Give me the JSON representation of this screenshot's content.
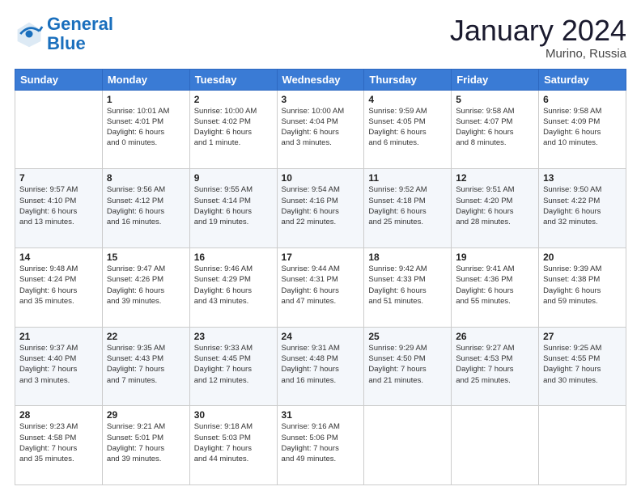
{
  "header": {
    "logo_general": "General",
    "logo_blue": "Blue",
    "month_title": "January 2024",
    "location": "Murino, Russia"
  },
  "weekdays": [
    "Sunday",
    "Monday",
    "Tuesday",
    "Wednesday",
    "Thursday",
    "Friday",
    "Saturday"
  ],
  "weeks": [
    [
      {
        "day": "",
        "info": ""
      },
      {
        "day": "1",
        "info": "Sunrise: 10:01 AM\nSunset: 4:01 PM\nDaylight: 6 hours\nand 0 minutes."
      },
      {
        "day": "2",
        "info": "Sunrise: 10:00 AM\nSunset: 4:02 PM\nDaylight: 6 hours\nand 1 minute."
      },
      {
        "day": "3",
        "info": "Sunrise: 10:00 AM\nSunset: 4:04 PM\nDaylight: 6 hours\nand 3 minutes."
      },
      {
        "day": "4",
        "info": "Sunrise: 9:59 AM\nSunset: 4:05 PM\nDaylight: 6 hours\nand 6 minutes."
      },
      {
        "day": "5",
        "info": "Sunrise: 9:58 AM\nSunset: 4:07 PM\nDaylight: 6 hours\nand 8 minutes."
      },
      {
        "day": "6",
        "info": "Sunrise: 9:58 AM\nSunset: 4:09 PM\nDaylight: 6 hours\nand 10 minutes."
      }
    ],
    [
      {
        "day": "7",
        "info": "Sunrise: 9:57 AM\nSunset: 4:10 PM\nDaylight: 6 hours\nand 13 minutes."
      },
      {
        "day": "8",
        "info": "Sunrise: 9:56 AM\nSunset: 4:12 PM\nDaylight: 6 hours\nand 16 minutes."
      },
      {
        "day": "9",
        "info": "Sunrise: 9:55 AM\nSunset: 4:14 PM\nDaylight: 6 hours\nand 19 minutes."
      },
      {
        "day": "10",
        "info": "Sunrise: 9:54 AM\nSunset: 4:16 PM\nDaylight: 6 hours\nand 22 minutes."
      },
      {
        "day": "11",
        "info": "Sunrise: 9:52 AM\nSunset: 4:18 PM\nDaylight: 6 hours\nand 25 minutes."
      },
      {
        "day": "12",
        "info": "Sunrise: 9:51 AM\nSunset: 4:20 PM\nDaylight: 6 hours\nand 28 minutes."
      },
      {
        "day": "13",
        "info": "Sunrise: 9:50 AM\nSunset: 4:22 PM\nDaylight: 6 hours\nand 32 minutes."
      }
    ],
    [
      {
        "day": "14",
        "info": "Sunrise: 9:48 AM\nSunset: 4:24 PM\nDaylight: 6 hours\nand 35 minutes."
      },
      {
        "day": "15",
        "info": "Sunrise: 9:47 AM\nSunset: 4:26 PM\nDaylight: 6 hours\nand 39 minutes."
      },
      {
        "day": "16",
        "info": "Sunrise: 9:46 AM\nSunset: 4:29 PM\nDaylight: 6 hours\nand 43 minutes."
      },
      {
        "day": "17",
        "info": "Sunrise: 9:44 AM\nSunset: 4:31 PM\nDaylight: 6 hours\nand 47 minutes."
      },
      {
        "day": "18",
        "info": "Sunrise: 9:42 AM\nSunset: 4:33 PM\nDaylight: 6 hours\nand 51 minutes."
      },
      {
        "day": "19",
        "info": "Sunrise: 9:41 AM\nSunset: 4:36 PM\nDaylight: 6 hours\nand 55 minutes."
      },
      {
        "day": "20",
        "info": "Sunrise: 9:39 AM\nSunset: 4:38 PM\nDaylight: 6 hours\nand 59 minutes."
      }
    ],
    [
      {
        "day": "21",
        "info": "Sunrise: 9:37 AM\nSunset: 4:40 PM\nDaylight: 7 hours\nand 3 minutes."
      },
      {
        "day": "22",
        "info": "Sunrise: 9:35 AM\nSunset: 4:43 PM\nDaylight: 7 hours\nand 7 minutes."
      },
      {
        "day": "23",
        "info": "Sunrise: 9:33 AM\nSunset: 4:45 PM\nDaylight: 7 hours\nand 12 minutes."
      },
      {
        "day": "24",
        "info": "Sunrise: 9:31 AM\nSunset: 4:48 PM\nDaylight: 7 hours\nand 16 minutes."
      },
      {
        "day": "25",
        "info": "Sunrise: 9:29 AM\nSunset: 4:50 PM\nDaylight: 7 hours\nand 21 minutes."
      },
      {
        "day": "26",
        "info": "Sunrise: 9:27 AM\nSunset: 4:53 PM\nDaylight: 7 hours\nand 25 minutes."
      },
      {
        "day": "27",
        "info": "Sunrise: 9:25 AM\nSunset: 4:55 PM\nDaylight: 7 hours\nand 30 minutes."
      }
    ],
    [
      {
        "day": "28",
        "info": "Sunrise: 9:23 AM\nSunset: 4:58 PM\nDaylight: 7 hours\nand 35 minutes."
      },
      {
        "day": "29",
        "info": "Sunrise: 9:21 AM\nSunset: 5:01 PM\nDaylight: 7 hours\nand 39 minutes."
      },
      {
        "day": "30",
        "info": "Sunrise: 9:18 AM\nSunset: 5:03 PM\nDaylight: 7 hours\nand 44 minutes."
      },
      {
        "day": "31",
        "info": "Sunrise: 9:16 AM\nSunset: 5:06 PM\nDaylight: 7 hours\nand 49 minutes."
      },
      {
        "day": "",
        "info": ""
      },
      {
        "day": "",
        "info": ""
      },
      {
        "day": "",
        "info": ""
      }
    ]
  ]
}
